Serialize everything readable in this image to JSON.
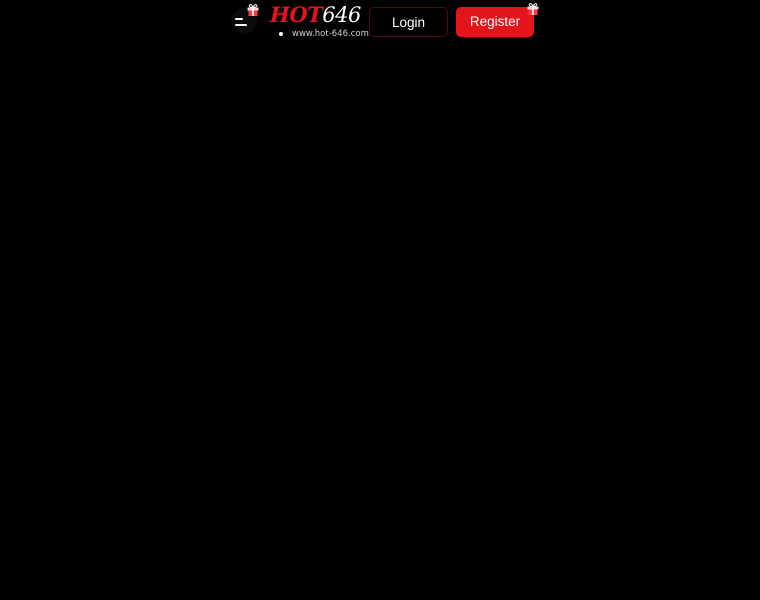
{
  "header": {
    "logo": {
      "brand_part1": "HOT",
      "brand_part2": "646",
      "url": "www.hot-646.com"
    },
    "login_label": "Login",
    "register_label": "Register"
  },
  "icons": {
    "menu": "menu-icon",
    "gift": "gift-icon"
  },
  "colors": {
    "background": "#000000",
    "accent": "#e3141c",
    "text": "#ffffff"
  }
}
